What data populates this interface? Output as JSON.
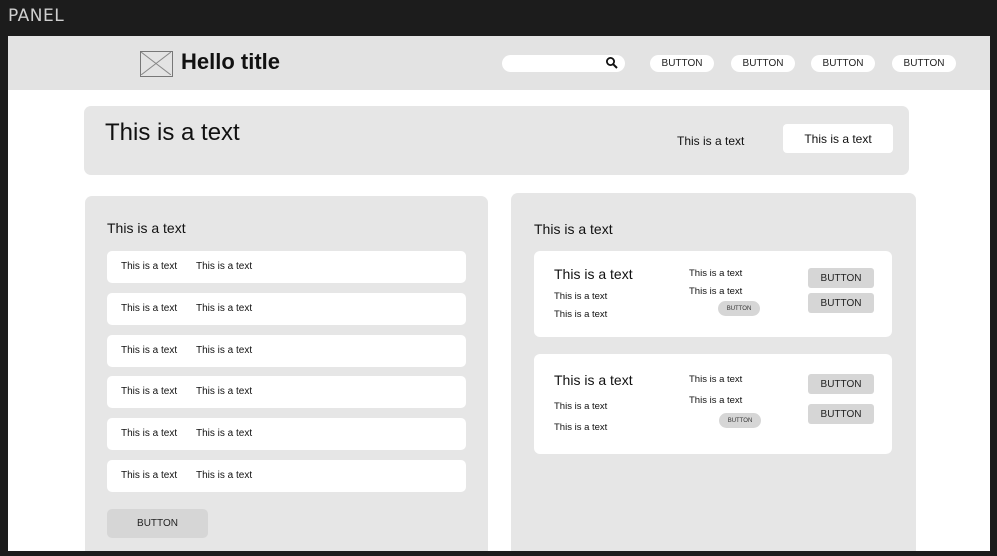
{
  "window": {
    "panel_label": "PANEL"
  },
  "header": {
    "title": "Hello title",
    "logo_icon": "image-placeholder-icon",
    "search": {
      "value": "",
      "icon": "search-icon"
    },
    "nav_buttons": [
      "BUTTON",
      "BUTTON",
      "BUTTON",
      "BUTTON"
    ]
  },
  "hero": {
    "title": "This is a text",
    "text": "This is a text",
    "button": "This is a text"
  },
  "left_card": {
    "heading": "This is a text",
    "items": [
      {
        "a": "This is a text",
        "b": "This is a text"
      },
      {
        "a": "This is a text",
        "b": "This is a text"
      },
      {
        "a": "This is a text",
        "b": "This is a text"
      },
      {
        "a": "This is a text",
        "b": "This is a text"
      },
      {
        "a": "This is a text",
        "b": "This is a text"
      },
      {
        "a": "This is a text",
        "b": "This is a text"
      }
    ],
    "button": "BUTTON"
  },
  "right_card": {
    "heading": "This is a text",
    "cards": [
      {
        "title": "This is a text",
        "left_lines": [
          "This is a text",
          "This is a text"
        ],
        "mid_lines": [
          "This is a text",
          "This is a text"
        ],
        "pill": "BUTTON",
        "buttons": [
          "BUTTON",
          "BUTTON"
        ]
      },
      {
        "title": "This is a text",
        "left_lines": [
          "This is a text",
          "This is a text"
        ],
        "mid_lines": [
          "This is a text",
          "This is a text"
        ],
        "pill": "BUTTON",
        "buttons": [
          "BUTTON",
          "BUTTON"
        ]
      }
    ]
  }
}
